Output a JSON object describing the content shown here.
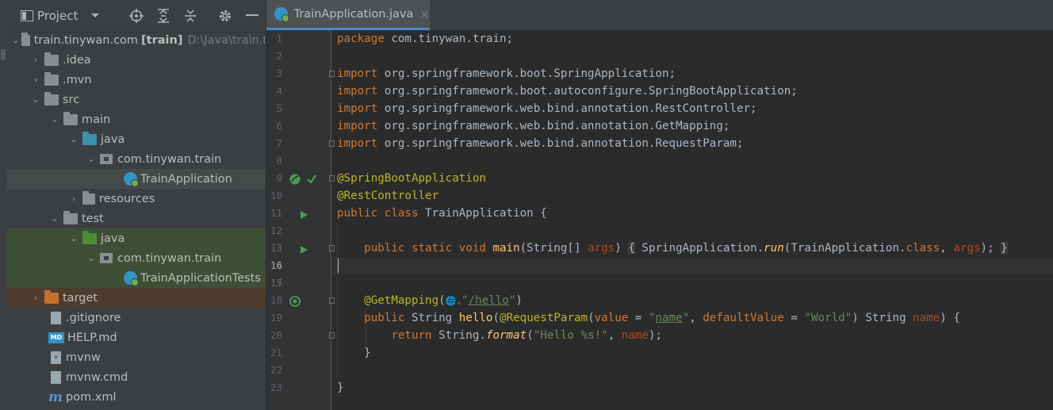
{
  "project_panel": {
    "title": "Project",
    "tree": [
      {
        "name": "train.tinywan.com",
        "badge": "[train]",
        "path": "D:\\Java\\train.ti"
      },
      {
        "name": ".idea"
      },
      {
        "name": ".mvn"
      },
      {
        "name": "src"
      },
      {
        "name": "main"
      },
      {
        "name": "java"
      },
      {
        "name": "com.tinywan.train"
      },
      {
        "name": "TrainApplication"
      },
      {
        "name": "resources"
      },
      {
        "name": "test"
      },
      {
        "name": "java"
      },
      {
        "name": "com.tinywan.train"
      },
      {
        "name": "TrainApplicationTests"
      },
      {
        "name": "target"
      },
      {
        "name": ".gitignore"
      },
      {
        "name": "HELP.md",
        "icon_text": "MD"
      },
      {
        "name": "mvnw"
      },
      {
        "name": "mvnw.cmd"
      },
      {
        "name": "pom.xml"
      }
    ]
  },
  "editor": {
    "tab": {
      "label": "TrainApplication.java",
      "close": "×"
    },
    "line_numbers": [
      "1",
      "2",
      "3",
      "4",
      "5",
      "6",
      "7",
      "8",
      "9",
      "10",
      "11",
      "12",
      "13",
      "14",
      "15",
      "16",
      "17",
      "18",
      "19",
      "20",
      "21",
      "22",
      "23"
    ],
    "current_line": "16",
    "code": {
      "l1": {
        "kw": "package",
        "rest": " com.tinywan.train;"
      },
      "l3": {
        "kw": "import",
        "rest": " org.springframework.boot.SpringApplication;"
      },
      "l4": {
        "kw": "import",
        "rest": " org.springframework.boot.autoconfigure.SpringBootApplication;"
      },
      "l5": {
        "kw": "import",
        "rest": " org.springframework.web.bind.annotation.RestController;"
      },
      "l6": {
        "kw": "import",
        "rest": " org.springframework.web.bind.annotation.GetMapping;"
      },
      "l7": {
        "kw": "import",
        "rest": " org.springframework.web.bind.annotation.RequestParam;"
      },
      "l9": {
        "an": "@SpringBootApplication"
      },
      "l10": {
        "an": "@RestController"
      },
      "l11": {
        "kw": "public class",
        "cls": " TrainApplication {"
      },
      "l13": {
        "indent": "    ",
        "kw": "public static void",
        "fn": "main",
        "p1": "(String[] ",
        "pm": "args",
        "p2": ") ",
        "b1": "{",
        "call1": " SpringApplication.",
        "fn2": "run",
        "p3": "(TrainApplication.",
        "kw2": "class",
        "p4": ", ",
        "pm2": "args",
        "p5": "); ",
        "b2": "}"
      },
      "l17": {
        "indent": "    ",
        "an": "@GetMapping",
        "p1": "(",
        "hint": "🌐⌄",
        "st": "\"",
        "url": "/hello",
        "st2": "\"",
        "p2": ")"
      },
      "l18": {
        "indent": "    ",
        "kw": "public",
        "t1": " String ",
        "fn": "hello",
        "p1": "(",
        "an": "@RequestParam",
        "p2": "(",
        "k1": "value",
        "p3": " = ",
        "st1": "\"",
        "st1u": "name",
        "st1e": "\"",
        "p4": ", ",
        "k2": "defaultValue",
        "p5": " = ",
        "st2": "\"World\"",
        "p6": ") String ",
        "pm": "name",
        "p7": ") {"
      },
      "l19": {
        "indent": "        ",
        "kw": "return",
        "t1": " String.",
        "fn": "format",
        "p1": "(",
        "st": "\"Hello %s!\"",
        "p2": ", ",
        "pm": "name",
        "p3": ");"
      },
      "l20": {
        "indent": "    ",
        "t": "}"
      },
      "l22": {
        "t": "}"
      }
    }
  },
  "colors": {
    "keyword": "#cc7832",
    "annotation": "#bbb529",
    "string": "#6a8759",
    "method": "#ffc66d",
    "param": "#aa4926",
    "accent": "#4a88c7"
  }
}
